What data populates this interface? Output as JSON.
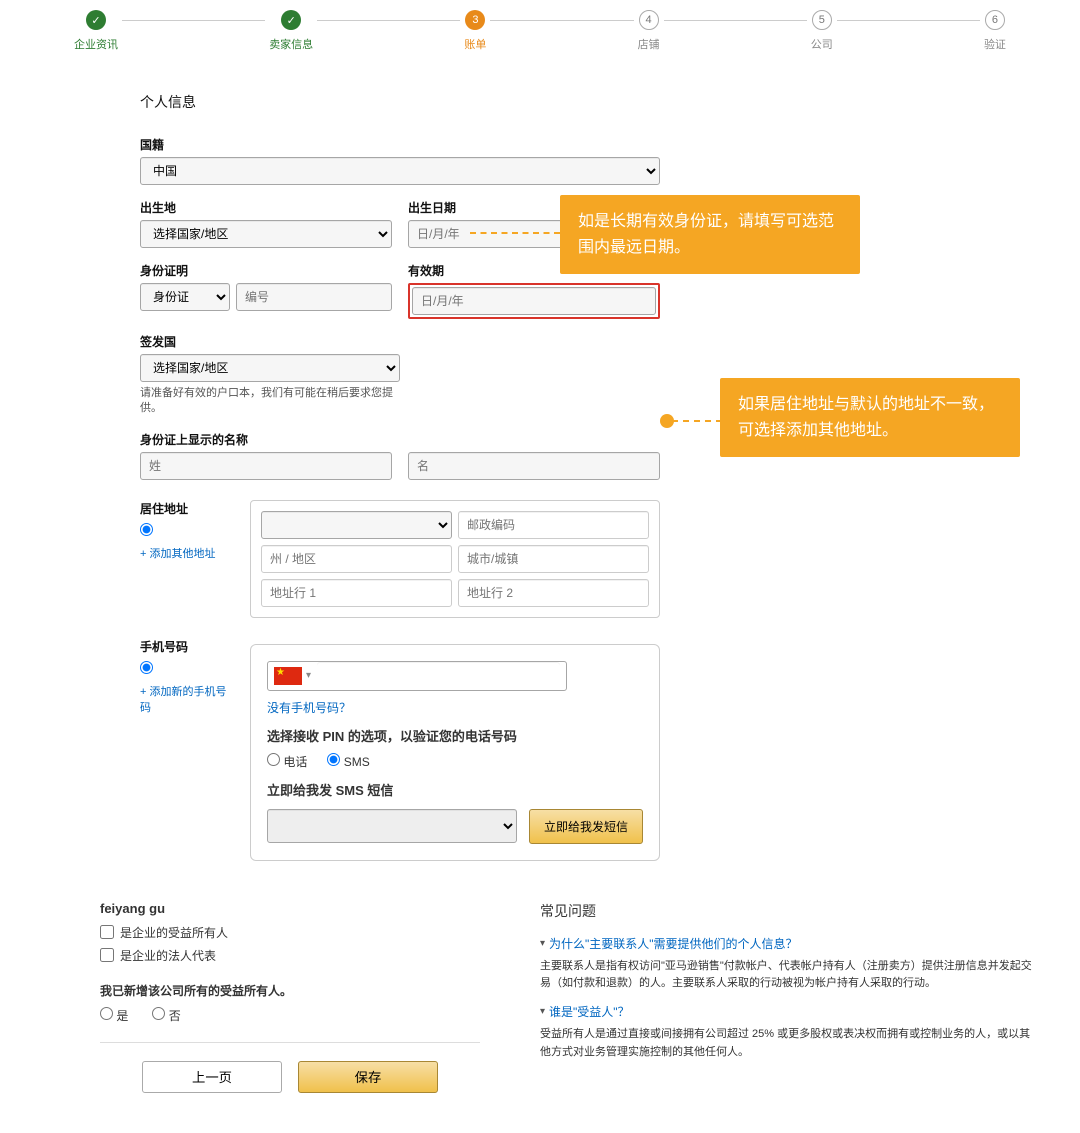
{
  "stepper": {
    "steps": [
      {
        "label": "企业资讯",
        "state": "done",
        "num": "✓"
      },
      {
        "label": "卖家信息",
        "state": "done",
        "num": "✓"
      },
      {
        "label": "账单",
        "state": "current",
        "num": "3"
      },
      {
        "label": "店铺",
        "state": "pending",
        "num": "4"
      },
      {
        "label": "公司",
        "state": "pending",
        "num": "5"
      },
      {
        "label": "验证",
        "state": "pending",
        "num": "6"
      }
    ]
  },
  "section_title": "个人信息",
  "fields": {
    "nationality_label": "国籍",
    "nationality_value": "中国",
    "birthplace_label": "出生地",
    "birthplace_placeholder": "选择国家/地区",
    "birthdate_label": "出生日期",
    "birthdate_placeholder": "日/月/年",
    "id_label": "身份证明",
    "id_select_value": "身份证",
    "id_number_placeholder": "编号",
    "expiry_label": "有效期",
    "expiry_placeholder": "日/月/年",
    "issuing_label": "签发国",
    "issuing_placeholder": "选择国家/地区",
    "issuing_helper": "请准备好有效的户口本，我们有可能在稍后要求您提供。",
    "id_name_label": "身份证上显示的名称",
    "surname_placeholder": "姓",
    "given_placeholder": "名"
  },
  "address": {
    "label": "居住地址",
    "add_link": "+ 添加其他地址",
    "placeholders": {
      "country": "",
      "postal": "邮政编码",
      "state": "州 / 地区",
      "city": "城市/城镇",
      "line1": "地址行 1",
      "line2": "地址行 2"
    }
  },
  "phone": {
    "label": "手机号码",
    "add_link": "+ 添加新的手机号码",
    "no_phone_link": "没有手机号码？",
    "pin_title": "选择接收 PIN 的选项，以验证您的电话号码",
    "option_phone": "电话",
    "option_sms": "SMS",
    "sms_title": "立即给我发 SMS 短信",
    "send_button": "立即给我发短信"
  },
  "lower": {
    "username": "feiyang gu",
    "check1": "是企业的受益所有人",
    "check2": "是企业的法人代表",
    "question": "我已新增该公司所有的受益所有人。",
    "yes": "是",
    "no": "否",
    "prev_button": "上一页",
    "save_button": "保存"
  },
  "faq": {
    "title": "常见问题",
    "q1": "为什么\"主要联系人\"需要提供他们的个人信息？",
    "a1": "主要联系人是指有权访问\"亚马逊销售\"付款帐户、代表帐户持有人（注册卖方）提供注册信息并发起交易（如付款和退款）的人。主要联系人采取的行动被视为帐户持有人采取的行动。",
    "q2": "谁是\"受益人\"？",
    "a2": "受益所有人是通过直接或间接拥有公司超过 25% 或更多股权或表决权而拥有或控制业务的人，或以其他方式对业务管理实施控制的其他任何人。"
  },
  "callouts": {
    "c1": "如是长期有效身份证，请填写可选范围内最远日期。",
    "c2": "如果居住地址与默认的地址不一致，可选择添加其他地址。"
  }
}
